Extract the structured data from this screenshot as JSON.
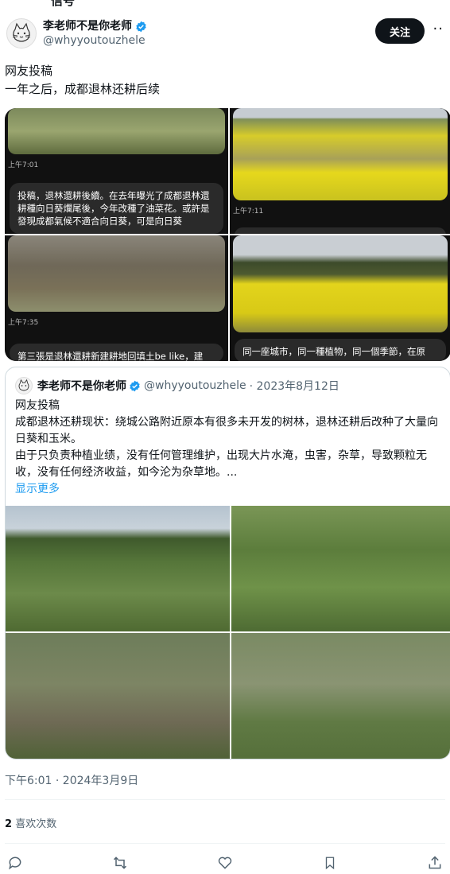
{
  "top_cut_text": "信号",
  "author": {
    "display_name": "李老师不是你老师",
    "handle": "@whyyoutouzhele",
    "verified_icon": "verified-badge-icon"
  },
  "follow_label": "关注",
  "more_label": "··",
  "tweet": {
    "line1": "网友投稿",
    "line2": "一年之后，成都退林还耕后续"
  },
  "media": [
    {
      "time": "上午7:01",
      "text": "投稿，退林還耕後續。在去年曝光了成都退林還耕種向日葵爛尾後，今年改種了油菜花。或許是發現成都氣候不適合向日葵，可是向日葵",
      "colors": {
        "top": "#8a9a6a",
        "bottom": "#6d7b4a"
      }
    },
    {
      "time": "上午7:11",
      "text": "",
      "colors": {
        "top": "#b8c3cc",
        "bottom": "#e3d21a"
      }
    },
    {
      "time": "上午7:35",
      "text": "第三張是退林還耕新建耕地回填土be like，建",
      "colors": {
        "top": "#6f6a5c",
        "bottom": "#5d5646"
      }
    },
    {
      "time": "",
      "text": "同一座城市，同一種植物，同一個季節，在原",
      "colors": {
        "top": "#c7ccd0",
        "bottom": "#d9cc20"
      }
    }
  ],
  "quote": {
    "display_name": "李老师不是你老师",
    "handle": "@whyyoutouzhele",
    "date": "· 2023年8月12日",
    "p1": "网友投稿",
    "p2": "成都退林还耕现状：绕城公路附近原本有很多未开发的树林，退林还耕后改种了大量向日葵和玉米。",
    "p3": "由于只负责种植业绩，没有任何管理维护，出现大片水淹，虫害，杂草，导致颗粒无收，没有任何经济收益，如今沦为杂草地。...",
    "show_more": "显示更多"
  },
  "timestamp": "下午6:01 · 2024年3月9日",
  "likes": {
    "count": "2",
    "label": "喜欢次数"
  },
  "actions": [
    "reply-icon",
    "retweet-icon",
    "like-icon",
    "bookmark-icon",
    "share-icon"
  ]
}
